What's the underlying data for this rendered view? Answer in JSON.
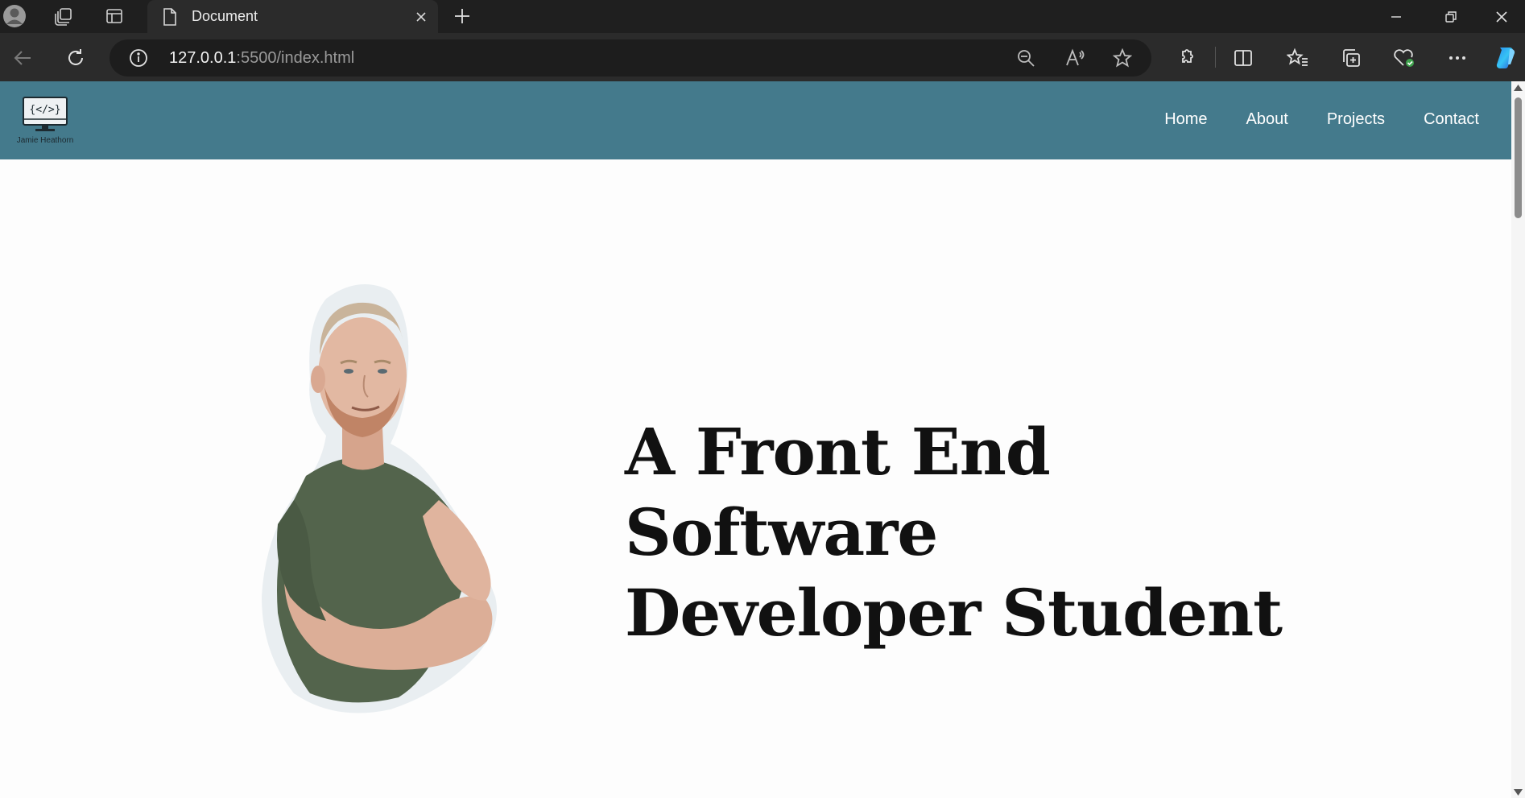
{
  "browser": {
    "tab": {
      "title": "Document"
    },
    "address": {
      "host": "127.0.0.1",
      "path": ":5500/index.html"
    }
  },
  "page": {
    "logo": {
      "glyph": "{</>}",
      "caption": "Jamie Heathorn"
    },
    "nav": [
      "Home",
      "About",
      "Projects",
      "Contact"
    ],
    "hero": {
      "heading_line1": "A Front End Software",
      "heading_line2": "Developer Student"
    }
  },
  "colors": {
    "navbar": "#447a8c",
    "page_bg": "#fdfdfd",
    "chrome_dark": "#1f1f1f",
    "chrome_toolbar": "#2b2b2b"
  }
}
